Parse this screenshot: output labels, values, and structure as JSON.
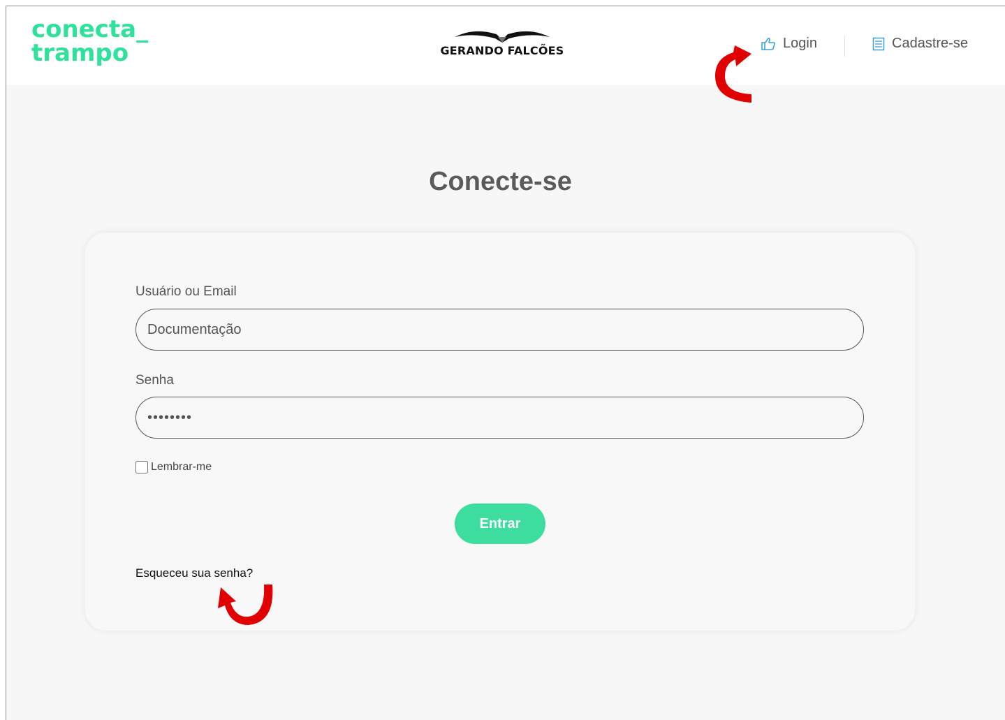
{
  "header": {
    "logo_line1": "conecta_",
    "logo_line2": "trampo",
    "brand_name": "GERANDO FALCÕES",
    "nav": {
      "login_label": "Login",
      "register_label": "Cadastre-se"
    }
  },
  "main": {
    "title": "Conecte-se",
    "form": {
      "username_label": "Usuário ou Email",
      "username_value": "Documentação",
      "password_label": "Senha",
      "password_value": "••••••••",
      "remember_label": "Lembrar-me",
      "submit_label": "Entrar",
      "forgot_label": "Esqueceu sua senha?"
    }
  },
  "colors": {
    "accent": "#3ddc9f",
    "logo": "#2ee29c",
    "annotation": "#e00000"
  },
  "icons": {
    "login": "thumbs-up-icon",
    "register": "form-icon"
  }
}
